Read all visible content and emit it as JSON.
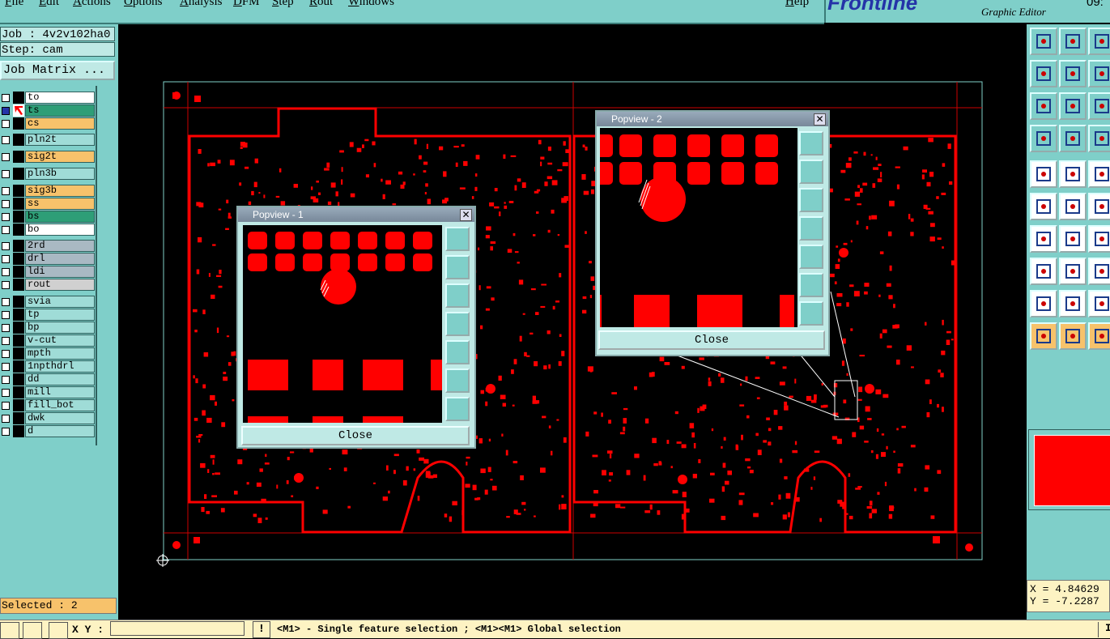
{
  "menubar": {
    "items": [
      "File",
      "Edit",
      "Actions",
      "Options",
      "Analysis",
      "DFM",
      "Step",
      "Rout",
      "Windows"
    ],
    "help": "Help"
  },
  "brand": {
    "logo_text": "Frontline",
    "subtitle": "Graphic Editor",
    "clock": "09:"
  },
  "job": {
    "job_label": "Job : 4v2v102ha0",
    "step_label": "Step: cam",
    "matrix_button": "Job Matrix ..."
  },
  "layers": [
    {
      "name": "to",
      "color": "#ffffff"
    },
    {
      "name": "ts",
      "color": "#2e9e77",
      "active": true
    },
    {
      "name": "cs",
      "color": "#f7c26b"
    },
    {
      "name": "pln2t",
      "color": "#9fdcd7"
    },
    {
      "name": "sig2t",
      "color": "#f7c26b"
    },
    {
      "name": "pln3b",
      "color": "#9fdcd7"
    },
    {
      "name": "sig3b",
      "color": "#f7c26b"
    },
    {
      "name": "ss",
      "color": "#f7c26b"
    },
    {
      "name": "bs",
      "color": "#2e9e77"
    },
    {
      "name": "bo",
      "color": "#ffffff"
    },
    {
      "name": "2rd",
      "color": "#a9b9c3"
    },
    {
      "name": "drl",
      "color": "#a9b9c3"
    },
    {
      "name": "ldi",
      "color": "#a9b9c3"
    },
    {
      "name": "rout",
      "color": "#d0d0d0"
    },
    {
      "name": "svia",
      "color": "#9fdcd7"
    },
    {
      "name": "tp",
      "color": "#9fdcd7"
    },
    {
      "name": "bp",
      "color": "#9fdcd7"
    },
    {
      "name": "v-cut",
      "color": "#9fdcd7"
    },
    {
      "name": "mpth",
      "color": "#9fdcd7"
    },
    {
      "name": "1npthdrl",
      "color": "#9fdcd7"
    },
    {
      "name": "dd",
      "color": "#9fdcd7"
    },
    {
      "name": "mill",
      "color": "#9fdcd7"
    },
    {
      "name": "fill_bot",
      "color": "#9fdcd7"
    },
    {
      "name": "dwk",
      "color": "#9fdcd7"
    },
    {
      "name": "d",
      "color": "#9fdcd7"
    }
  ],
  "selected": "Selected : 2",
  "popview1": {
    "title": "Popview - 1",
    "close_label": "Close"
  },
  "popview2": {
    "title": "Popview - 2",
    "close_label": "Close"
  },
  "coords": {
    "x": "X = 4.84629",
    "y": "Y = -7.2287"
  },
  "statusbar": {
    "xy_label": "X Y :",
    "xy_value": "",
    "hint": "<M1> - Single feature selection ; <M1><M1> Global selection",
    "right_text": "I"
  },
  "colors": {
    "panel": "#7fcfc9",
    "copper": "#ff0000",
    "board_outline": "#7fcfc9"
  }
}
